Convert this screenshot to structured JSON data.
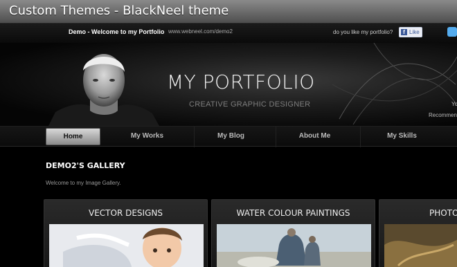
{
  "window": {
    "title": "Custom Themes - BlackNeel theme"
  },
  "topstrip": {
    "site_title": "Demo - Welcome to my Portfolio",
    "site_url": "www.webneel.com/demo2",
    "like_question": "do you like my portfolio?",
    "like_label": "Like"
  },
  "header": {
    "brand": "MY PORTFOLIO",
    "tagline": "CREATIVE GRAPHIC DESIGNER",
    "side_text_1": "Yo",
    "side_text_2": "Recommen"
  },
  "nav": {
    "items": [
      {
        "label": "Home",
        "active": true
      },
      {
        "label": "My Works",
        "active": false
      },
      {
        "label": "My Blog",
        "active": false
      },
      {
        "label": "About Me",
        "active": false
      },
      {
        "label": "My Skills",
        "active": false
      }
    ]
  },
  "gallery": {
    "title": "DEMO2'S GALLERY",
    "subtitle": "Welcome to my Image Gallery.",
    "cards": [
      {
        "title": "VECTOR DESIGNS"
      },
      {
        "title": "WATER COLOUR PAINTINGS"
      },
      {
        "title": "PHOTO"
      }
    ]
  },
  "colors": {
    "titlebar_top": "#8a8a8a",
    "titlebar_bottom": "#4e4e4e",
    "background": "#000000",
    "facebook_blue": "#3b5998",
    "twitter_blue": "#55acee"
  }
}
